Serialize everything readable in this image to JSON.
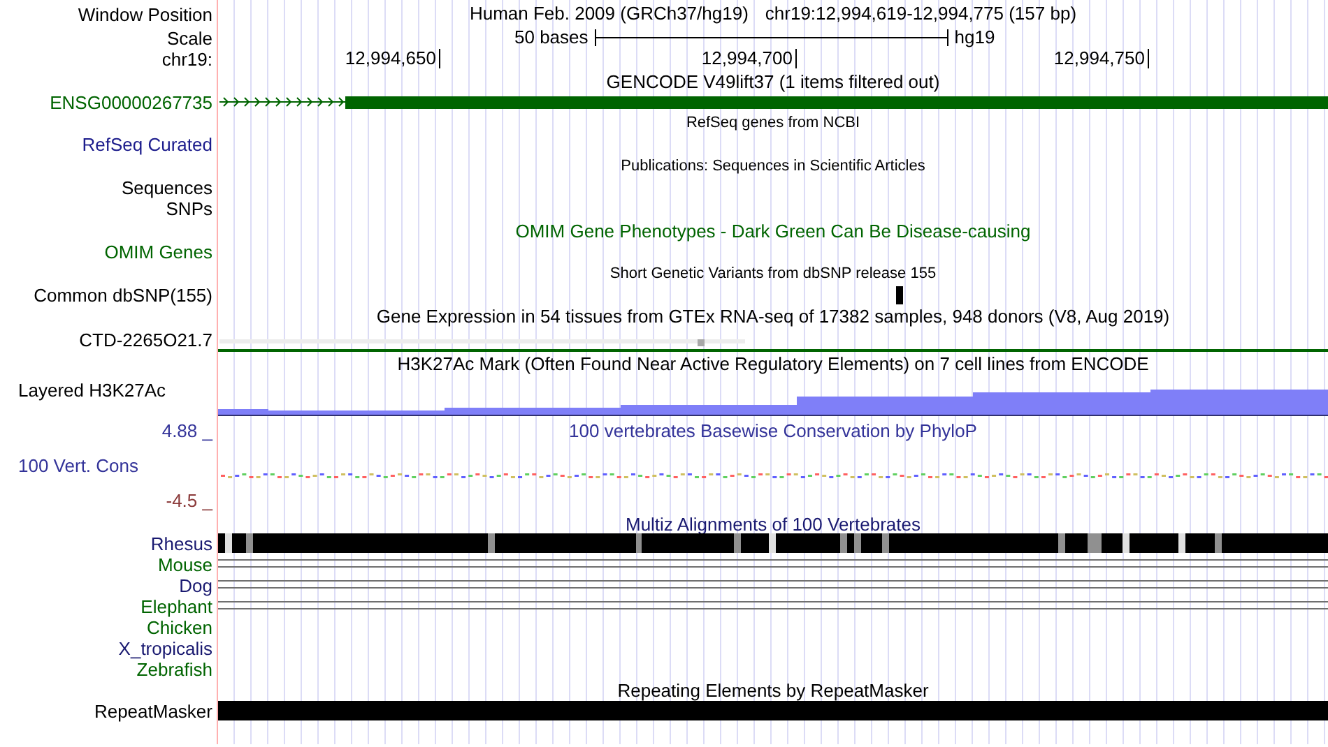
{
  "window_position": {
    "label": "Window Position",
    "assembly": "Human Feb. 2009 (GRCh37/hg19)",
    "position": "chr19:12,994,619-12,994,775 (157 bp)"
  },
  "scale": {
    "label": "Scale",
    "span": "50 bases",
    "assembly": "hg19"
  },
  "ruler": {
    "label": "chr19:",
    "ticks": [
      "12,994,650",
      "12,994,700",
      "12,994,750"
    ]
  },
  "tracks": [
    {
      "kind": "gene",
      "title": {
        "text": "GENCODE V49lift37 (1 items filtered out)",
        "small": false,
        "color": "#000000"
      },
      "label": "ENSG00000267735",
      "color": "#006400"
    },
    {
      "kind": "empty",
      "title": {
        "text": "RefSeq genes from NCBI",
        "small": true,
        "color": "#000000"
      },
      "label": "RefSeq Curated",
      "color": "#1c1c8c"
    },
    {
      "kind": "empty",
      "title": {
        "text": "Publications: Sequences in Scientific Articles",
        "small": true,
        "color": "#000000"
      },
      "label": "Sequences",
      "color": "#000000"
    },
    {
      "kind": "empty",
      "label": "SNPs",
      "color": "#000000"
    },
    {
      "kind": "empty",
      "title": {
        "text": "OMIM Gene Phenotypes - Dark Green Can Be Disease-causing",
        "small": false,
        "color": "#006400"
      },
      "label": "OMIM Genes",
      "color": "#006400"
    },
    {
      "kind": "snp",
      "title": {
        "text": "Short Genetic Variants from dbSNP release 155",
        "small": true,
        "color": "#000000"
      },
      "label": "Common dbSNP(155)",
      "color": "#000000"
    },
    {
      "kind": "expression",
      "title": {
        "text": "Gene Expression in 54 tissues from GTEx RNA-seq of 17382 samples, 948 donors (V8, Aug 2019)",
        "small": false,
        "color": "#000000"
      },
      "label": "CTD-2265O21.7",
      "color": "#000000"
    },
    {
      "kind": "signal",
      "title": {
        "text": "H3K27Ac Mark (Often Found Near Active Regulatory Elements) on 7 cell lines from ENCODE",
        "small": false,
        "color": "#000000"
      },
      "label": "Layered H3K27Ac",
      "color": "#000000"
    },
    {
      "kind": "conservation",
      "title": {
        "text": "100 vertebrates Basewise Conservation by PhyloP",
        "small": false,
        "color": "#333399"
      },
      "label": "100 Vert. Cons",
      "color": "#333399",
      "ymax": "4.88 _",
      "ymin": "-4.5 _"
    },
    {
      "kind": "alignment",
      "title": {
        "text": "Multiz Alignments of 100 Vertebrates",
        "small": false,
        "color": "#191970"
      },
      "species": [
        {
          "name": "Rhesus",
          "color": "#191970",
          "kind": "blocks"
        },
        {
          "name": "Mouse",
          "color": "#006400",
          "kind": "double_line"
        },
        {
          "name": "Dog",
          "color": "#191970",
          "kind": "double_line"
        },
        {
          "name": "Elephant",
          "color": "#006400",
          "kind": "double_line"
        },
        {
          "name": "Chicken",
          "color": "#006400",
          "kind": "none"
        },
        {
          "name": "X_tropicalis",
          "color": "#191970",
          "kind": "none"
        },
        {
          "name": "Zebrafish",
          "color": "#006400",
          "kind": "none"
        }
      ]
    },
    {
      "kind": "repeat",
      "title": {
        "text": "Repeating Elements by RepeatMasker",
        "small": false,
        "color": "#000000"
      },
      "label": "RepeatMasker",
      "color": "#000000"
    }
  ]
}
